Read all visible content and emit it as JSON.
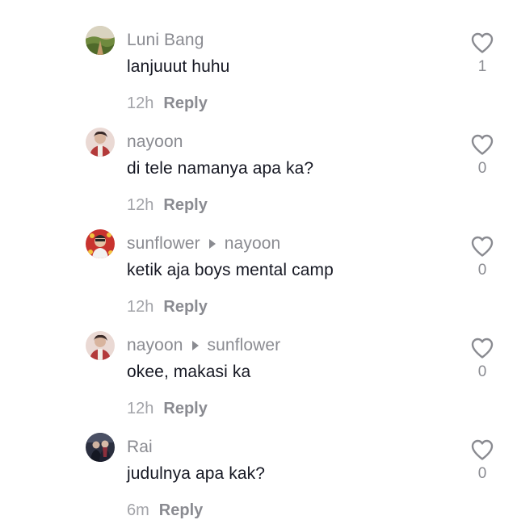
{
  "comments": [
    {
      "username": "Luni Bang",
      "reply_to": "",
      "text": "lanjuuut huhu",
      "time": "12h",
      "reply_label": "Reply",
      "likes": "1",
      "avatar_icon": "landscape-avatar"
    },
    {
      "username": "nayoon",
      "reply_to": "",
      "text": "di tele namanya apa ka?",
      "time": "12h",
      "reply_label": "Reply",
      "likes": "0",
      "avatar_icon": "person-avatar"
    },
    {
      "username": "sunflower",
      "reply_to": "nayoon",
      "text": "ketik aja boys mental camp",
      "time": "12h",
      "reply_label": "Reply",
      "likes": "0",
      "avatar_icon": "person-avatar"
    },
    {
      "username": "nayoon",
      "reply_to": "sunflower",
      "text": "okee, makasi ka",
      "time": "12h",
      "reply_label": "Reply",
      "likes": "0",
      "avatar_icon": "person-avatar"
    },
    {
      "username": "Rai",
      "reply_to": "",
      "text": "judulnya apa kak?",
      "time": "6m",
      "reply_label": "Reply",
      "likes": "0",
      "avatar_icon": "person-avatar"
    }
  ],
  "colors": {
    "username": "#8a8b91",
    "text": "#161823",
    "meta": "#a2a3a8",
    "icon": "#8a8b91",
    "background": "#ffffff"
  }
}
